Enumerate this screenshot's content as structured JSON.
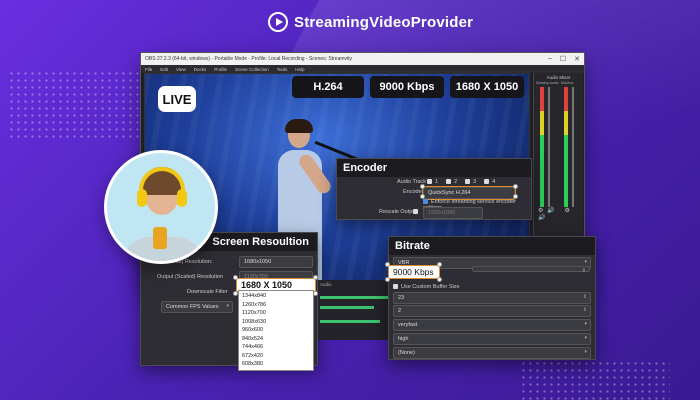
{
  "brand": {
    "name": "StreamingVideoProvider"
  },
  "window": {
    "title": "OBS 27.2.3 (64-bit, windows) - Portable Mode - Profile: Local Recording - Scenes: Streamvity",
    "menus": [
      "File",
      "Edit",
      "View",
      "Docks",
      "Profile",
      "Scene Collection",
      "Tools",
      "Help"
    ]
  },
  "badges": {
    "live": "LIVE",
    "codec": "H.264",
    "bitrate": "9000 Kbps",
    "resolution": "1680 X 1050"
  },
  "mixer": {
    "title": "Audio Mixer",
    "ch1": "Desktop Audio",
    "ch2": "Mic/Aux"
  },
  "encoder": {
    "title": "Encoder",
    "audio_track_label": "Audio Track",
    "tracks": [
      "1",
      "2",
      "3",
      "4"
    ],
    "encoder_label": "Encoder",
    "encoder_value": "QuickSync H.264",
    "enforce_label": "Enforce streaming service encoder settings",
    "rescale_label": "Rescale Output",
    "rescale_value": "1920x1080"
  },
  "resolution": {
    "title": "Screen Resoultion",
    "base_label": "(Canvas) Resolution:",
    "base_value": "1680x1050",
    "output_label": "Output (Scaled) Resolution",
    "output_value": "1680 X 1050",
    "output_small": "1120x700",
    "downscale_label": "Downscale Filter",
    "fps_label": "Common FPS Values",
    "options": [
      "1344x840",
      "1260x786",
      "1120x700",
      "1008x630",
      "960x600",
      "840x524",
      "744x466",
      "672x420",
      "608x380"
    ]
  },
  "bitrate": {
    "title": "Bitrate",
    "rc": "VBR",
    "value": "9000 Kbps",
    "custom_label": "Use Custom Buffer Size",
    "f1": "23",
    "f2": "2",
    "f3": "veryfast",
    "f4": "high",
    "f5": "(None)"
  },
  "timeline": {
    "label": "Audio"
  }
}
